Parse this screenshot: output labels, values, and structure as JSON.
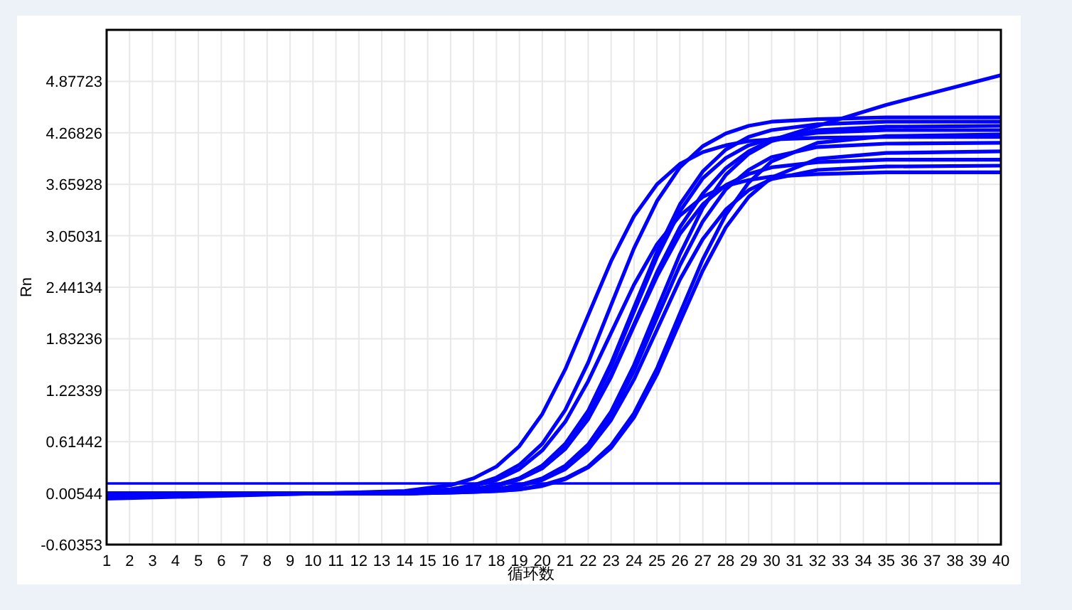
{
  "chart": {
    "chart_data": {
      "type": "line",
      "xlabel": "循环数",
      "ylabel": "Rn",
      "x": [
        1,
        10,
        14,
        16,
        17,
        18,
        19,
        20,
        21,
        22,
        23,
        24,
        25,
        26,
        27,
        28,
        29,
        30,
        32,
        35,
        40
      ],
      "xlim": [
        1,
        40
      ],
      "ylim": [
        -0.60353,
        5.4862
      ],
      "xticks": [
        1,
        2,
        3,
        4,
        5,
        6,
        7,
        8,
        9,
        10,
        11,
        12,
        13,
        14,
        15,
        16,
        17,
        18,
        19,
        20,
        21,
        22,
        23,
        24,
        25,
        26,
        27,
        28,
        29,
        30,
        31,
        32,
        33,
        34,
        35,
        36,
        37,
        38,
        39,
        40
      ],
      "yticks": [
        {
          "value": -0.60353,
          "label": "-0.60353"
        },
        {
          "value": 0.00544,
          "label": "0.00544"
        },
        {
          "value": 0.61442,
          "label": "0.61442"
        },
        {
          "value": 1.22339,
          "label": "1.22339"
        },
        {
          "value": 1.83236,
          "label": "1.83236"
        },
        {
          "value": 2.44134,
          "label": "2.44134"
        },
        {
          "value": 3.05031,
          "label": "3.05031"
        },
        {
          "value": 3.65928,
          "label": "3.65928"
        },
        {
          "value": 4.26826,
          "label": "4.26826"
        },
        {
          "value": 4.87723,
          "label": "4.87723"
        }
      ],
      "series": [
        {
          "color": "#0000ff",
          "values": [
            -0.06,
            0,
            0.03,
            0.1,
            0.18,
            0.32,
            0.56,
            0.94,
            1.47,
            2.11,
            2.75,
            3.28,
            3.66,
            3.9,
            4.04,
            4.12,
            4.17,
            4.19,
            4.21,
            4.22,
            4.22
          ]
        },
        {
          "color": "#0000ff",
          "values": [
            -0.04,
            0,
            0.02,
            0.05,
            0.1,
            0.19,
            0.34,
            0.59,
            0.99,
            1.55,
            2.23,
            2.9,
            3.46,
            3.86,
            4.11,
            4.26,
            4.35,
            4.4,
            4.43,
            4.45,
            4.45
          ]
        },
        {
          "color": "#0000ff",
          "values": [
            0,
            0,
            0.02,
            0.05,
            0.09,
            0.16,
            0.29,
            0.51,
            0.85,
            1.33,
            1.9,
            2.47,
            2.95,
            3.29,
            3.51,
            3.64,
            3.71,
            3.75,
            3.78,
            3.8,
            3.8
          ]
        },
        {
          "color": "#0000ff",
          "values": [
            -0.03,
            0,
            0.01,
            0.03,
            0.05,
            0.1,
            0.18,
            0.33,
            0.59,
            0.98,
            1.54,
            2.2,
            2.86,
            3.42,
            3.81,
            4.07,
            4.22,
            4.3,
            4.37,
            4.4,
            4.4
          ]
        },
        {
          "color": "#0000ff",
          "values": [
            0,
            0,
            0.01,
            0.03,
            0.05,
            0.1,
            0.18,
            0.33,
            0.57,
            0.96,
            1.5,
            2.15,
            2.8,
            3.34,
            3.73,
            3.97,
            4.12,
            4.2,
            4.27,
            4.3,
            4.3
          ]
        },
        {
          "color": "#0000ff",
          "values": [
            0,
            0,
            0.01,
            0.03,
            0.05,
            0.09,
            0.17,
            0.3,
            0.53,
            0.88,
            1.38,
            1.98,
            2.57,
            3.07,
            3.42,
            3.65,
            3.78,
            3.86,
            3.92,
            3.95,
            3.95
          ]
        },
        {
          "color": "#0000ff",
          "values": [
            0,
            0,
            0,
            0.02,
            0.03,
            0.05,
            0.1,
            0.18,
            0.33,
            0.58,
            0.97,
            1.52,
            2.18,
            2.83,
            3.38,
            3.77,
            4.02,
            4.17,
            4.3,
            4.34,
            4.35
          ]
        },
        {
          "color": "#0000ff",
          "values": [
            0,
            0,
            0,
            0.02,
            0.03,
            0.05,
            0.1,
            0.17,
            0.32,
            0.55,
            0.93,
            1.45,
            2.08,
            2.7,
            3.22,
            3.6,
            3.83,
            3.98,
            4.1,
            4.14,
            4.15
          ]
        },
        {
          "color": "#0000ff",
          "values": [
            0,
            0,
            0,
            0.02,
            0.03,
            0.05,
            0.09,
            0.16,
            0.29,
            0.52,
            0.87,
            1.35,
            1.94,
            2.53,
            3.01,
            3.36,
            3.59,
            3.72,
            3.83,
            3.87,
            3.88
          ]
        },
        {
          "color": "#0000ff",
          "values": [
            0,
            0,
            0,
            0.01,
            0.02,
            0.03,
            0.05,
            0.1,
            0.18,
            0.32,
            0.57,
            0.95,
            1.48,
            2.13,
            2.77,
            3.3,
            3.68,
            3.93,
            4.15,
            4.23,
            4.25
          ]
        },
        {
          "color": "#0000ff",
          "values": [
            0,
            0,
            0,
            0.01,
            0.02,
            0.03,
            0.05,
            0.09,
            0.17,
            0.31,
            0.54,
            0.9,
            1.41,
            2.03,
            2.64,
            3.15,
            3.51,
            3.74,
            3.96,
            4.03,
            4.05
          ]
        },
        {
          "color": "#0000ff",
          "values": [
            0,
            0,
            0.01,
            0.03,
            0.05,
            0.09,
            0.17,
            0.3,
            0.53,
            0.89,
            1.4,
            2,
            2.62,
            3.15,
            3.55,
            3.85,
            4.05,
            4.18,
            4.35,
            4.6,
            4.95
          ]
        },
        {
          "color": "#0000ff",
          "values": [
            0.12,
            0.12,
            0.12,
            0.12,
            0.12,
            0.12,
            0.12,
            0.12,
            0.12,
            0.12,
            0.12,
            0.12,
            0.12,
            0.12,
            0.12,
            0.12,
            0.12,
            0.12,
            0.12,
            0.12,
            0.12
          ]
        }
      ],
      "grid": true
    }
  }
}
